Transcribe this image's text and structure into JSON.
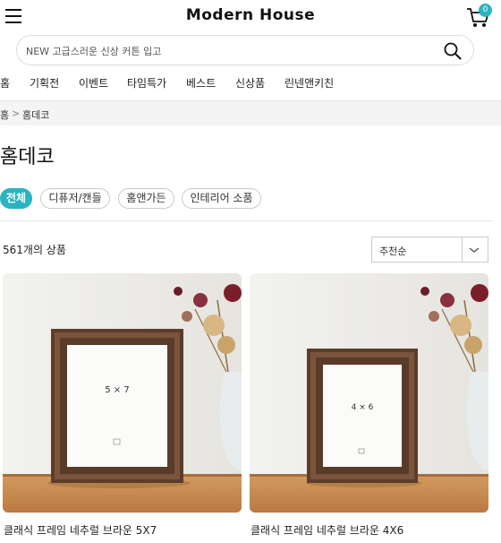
{
  "header": {
    "logo": "Modern House",
    "cart_count": "0"
  },
  "search": {
    "placeholder": "NEW 고급스러운 신상 커튼 입고"
  },
  "nav": {
    "items": [
      "홈",
      "기획전",
      "이벤트",
      "타임특가",
      "베스트",
      "신상품",
      "린넨앤키친"
    ]
  },
  "breadcrumb": {
    "home": "홈",
    "separator": ">",
    "current": "홈데코"
  },
  "page": {
    "title": "홈데코"
  },
  "filters": {
    "chips": [
      "전체",
      "디퓨저/캔들",
      "홈앤가든",
      "인테리어 소품"
    ],
    "active": "전체"
  },
  "listing": {
    "count_label": "561개의 상품",
    "sort_label": "추천순"
  },
  "products": [
    {
      "name": "클래식 프레임 네추럴 브라운 5X7",
      "frame_label": "5 × 7"
    },
    {
      "name": "클래식 프레임 네추럴 브라운 4X6",
      "frame_label": "4 × 6"
    }
  ],
  "colors": {
    "accent": "#2bb3c0",
    "frame_wood": "#6b4a35",
    "table_wood": "#c98d52"
  }
}
